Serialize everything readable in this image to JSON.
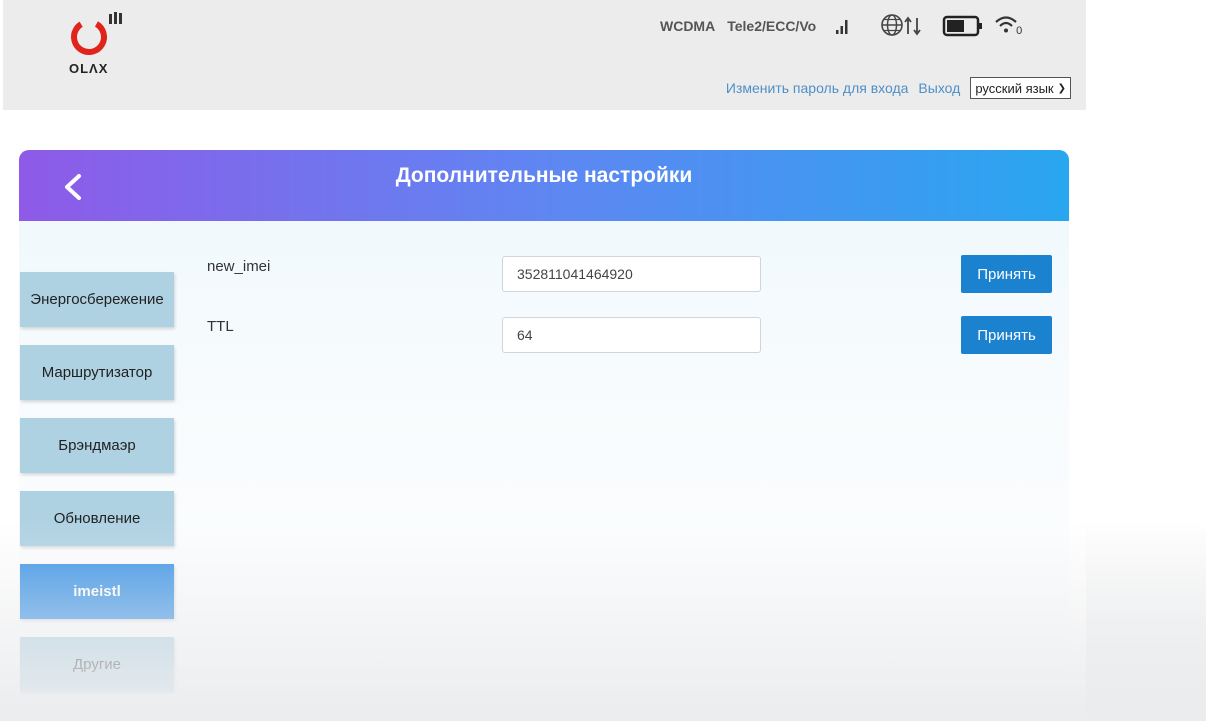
{
  "header": {
    "logo_text": "OLΛX",
    "network_type": "WCDMA",
    "operator": "Tele2/ECC/Vo",
    "wifi_clients": "0",
    "change_password_link": "Изменить пароль для входа",
    "logout_link": "Выход",
    "language_selected": "русский язык"
  },
  "panel": {
    "title": "Дополнительные настройки"
  },
  "sidebar": {
    "items": [
      {
        "label": "Энергосбережение"
      },
      {
        "label": "Маршрутизатор"
      },
      {
        "label": "Брэндмаэр"
      },
      {
        "label": "Обновление"
      },
      {
        "label": "imeistl",
        "active": true
      },
      {
        "label": "Другие"
      }
    ]
  },
  "form": {
    "imei": {
      "label": "new_imei",
      "value": "352811041464920",
      "button": "Принять"
    },
    "ttl": {
      "label": "TTL",
      "value": "64",
      "button": "Принять"
    }
  },
  "colors": {
    "header_bg": "#ececec",
    "gradient_start": "#8e5ae8",
    "gradient_end": "#29a6f0",
    "sidebar_item": "#afd2e3",
    "sidebar_active": "#3b93e6",
    "button": "#1b82d0",
    "link": "#4f8fc7"
  }
}
